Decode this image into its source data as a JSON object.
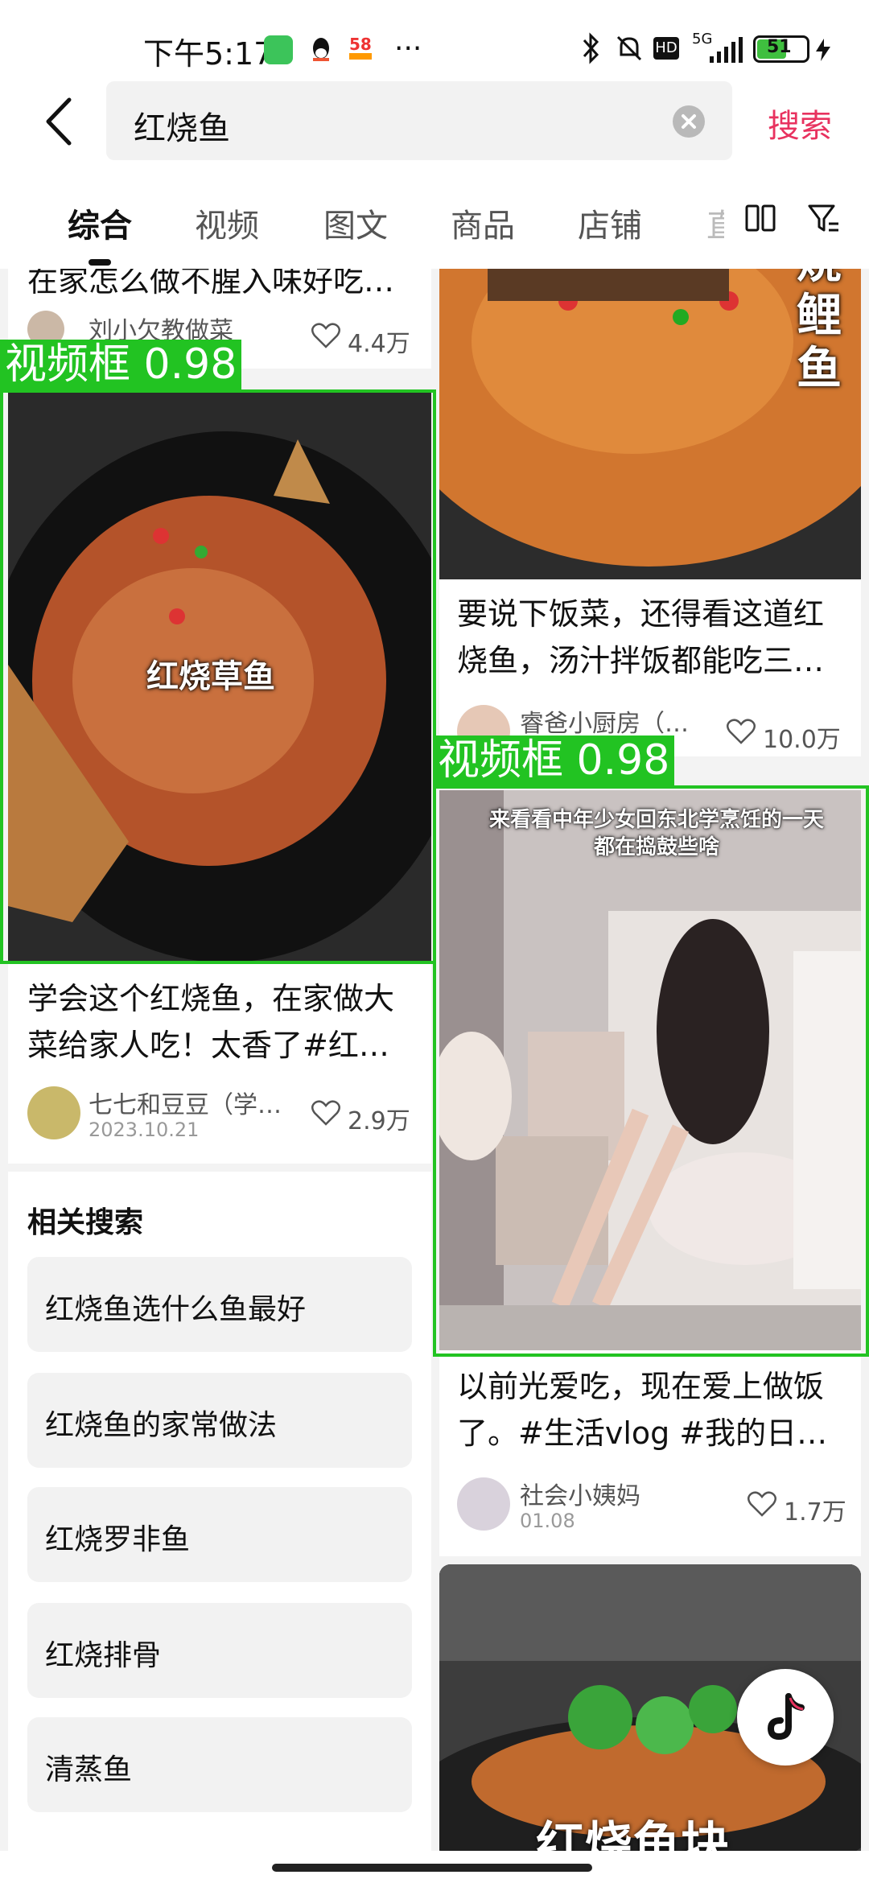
{
  "status_bar": {
    "time": "下午5:17",
    "battery": "51",
    "network": "5G"
  },
  "search": {
    "query": "红烧鱼",
    "search_button": "搜索"
  },
  "tabs": [
    "综合",
    "视频",
    "图文",
    "商品",
    "店铺",
    "直"
  ],
  "detection_label": "视频框 0.98",
  "left_column": {
    "top_card": {
      "title": "在家怎么做不腥入味好吃…",
      "author": "刘小欠教做菜",
      "likes": "4.4万"
    },
    "video_card": {
      "overlay_text": "红烧草鱼",
      "title": "学会这个红烧鱼，在家做大菜给家人吃！太香了#红…",
      "author": "七七和豆豆（学…",
      "date": "2023.10.21",
      "likes": "2.9万"
    },
    "related": {
      "title": "相关搜索",
      "items": [
        "红烧鱼选什么鱼最好",
        "红烧鱼的家常做法",
        "红烧罗非鱼",
        "红烧排骨",
        "清蒸鱼"
      ]
    }
  },
  "right_column": {
    "top_card": {
      "overlay_text": "烧鲤鱼",
      "title": "要说下饭菜，还得看这道红烧鱼，汤汁拌饭都能吃三…",
      "author": "睿爸小厨房（…",
      "likes": "10.0万"
    },
    "video_card": {
      "overlay_text": "来看看中年少女回东北学烹饪的一天都在捣鼓些啥",
      "title": "以前光爱吃，现在爱上做饭了。#生活vlog #我的日…",
      "author": "社会小姨妈",
      "date": "01.08",
      "likes": "1.7万"
    },
    "bottom_card": {
      "overlay_text": "红烧鱼块"
    }
  },
  "colors": {
    "accent": "#e8325f",
    "detection": "#22c322"
  }
}
